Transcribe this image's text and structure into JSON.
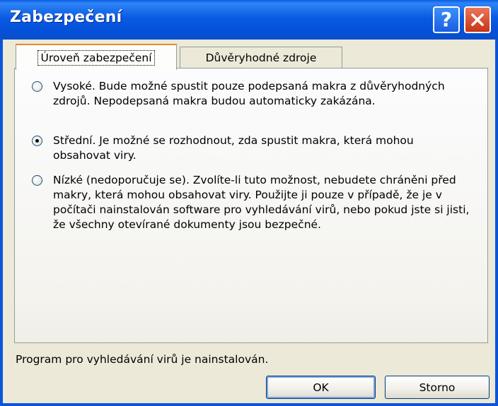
{
  "window": {
    "title": "Zabezpečení"
  },
  "tabs": [
    {
      "label": "Úroveň zabezpečení"
    },
    {
      "label": "Důvěryhodné zdroje"
    }
  ],
  "options": [
    {
      "text": "Vysoké. Bude možné spustit pouze podepsaná makra z důvěryhodných zdrojů. Nepodepsaná makra budou automaticky zakázána.",
      "checked": false
    },
    {
      "text": "Střední. Je možné se rozhodnout, zda spustit makra, která mohou obsahovat viry.",
      "checked": true
    },
    {
      "text": "Nízké (nedoporučuje se). Zvolíte-li tuto možnost, nebudete chráněni před makry, která mohou obsahovat viry. Použijte ji pouze v případě, že je v počítači nainstalován software pro vyhledávání virů, nebo pokud jste si jisti, že všechny otevírané dokumenty jsou bezpečné.",
      "checked": false
    }
  ],
  "status": {
    "text": "Program pro vyhledávání virů je nainstalován."
  },
  "buttons": {
    "ok": "OK",
    "cancel": "Storno"
  },
  "colors": {
    "titlebar": "#0a5ae3",
    "face": "#ece9d8",
    "active_tab_accent": "#e68b2c"
  }
}
